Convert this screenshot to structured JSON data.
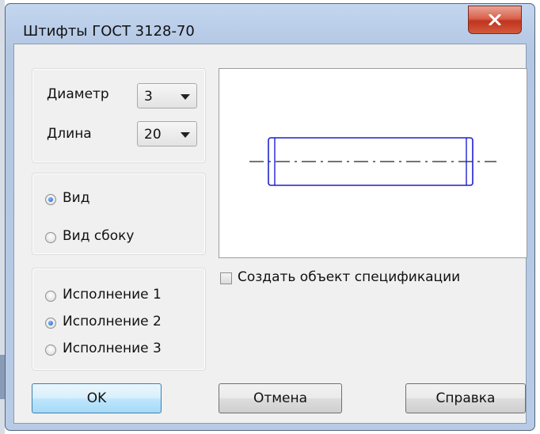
{
  "window": {
    "title": "Штифты ГОСТ 3128-70"
  },
  "params": {
    "diameter_label": "Диаметр",
    "diameter_value": "3",
    "length_label": "Длина",
    "length_value": "20"
  },
  "view": {
    "options": [
      {
        "label": "Вид",
        "selected": true
      },
      {
        "label": "Вид сбоку",
        "selected": false
      }
    ]
  },
  "execution": {
    "options": [
      {
        "label": "Исполнение 1",
        "selected": false
      },
      {
        "label": "Исполнение 2",
        "selected": true
      },
      {
        "label": "Исполнение 3",
        "selected": false
      }
    ]
  },
  "spec_checkbox": {
    "label": "Создать объект спецификации",
    "checked": false
  },
  "buttons": {
    "ok": "OK",
    "cancel": "Отмена",
    "help": "Справка"
  },
  "colors": {
    "drawing_line": "#1f1fd0",
    "titlebar": "#b9cde9",
    "close": "#c7432d"
  }
}
